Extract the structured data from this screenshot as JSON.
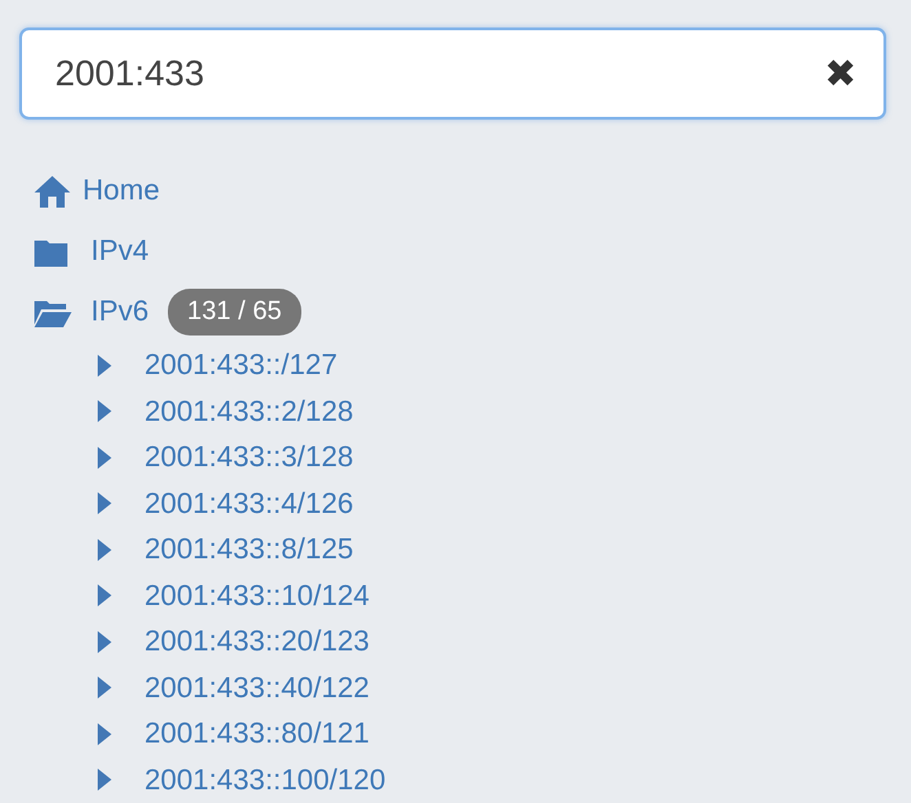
{
  "search": {
    "value": "2001:433",
    "clear_icon": "✖"
  },
  "tree": [
    {
      "label": "Home",
      "kind": "home"
    },
    {
      "label": "IPv4",
      "kind": "folder",
      "expanded": false
    },
    {
      "label": "IPv6",
      "kind": "folder",
      "expanded": true,
      "badge": "131 / 65",
      "children": [
        {
          "label": "2001:433::/127",
          "expanded": false
        },
        {
          "label": "2001:433::2/128",
          "expanded": false
        },
        {
          "label": "2001:433::3/128",
          "expanded": false
        },
        {
          "label": "2001:433::4/126",
          "expanded": false
        },
        {
          "label": "2001:433::8/125",
          "expanded": false
        },
        {
          "label": "2001:433::10/124",
          "expanded": false
        },
        {
          "label": "2001:433::20/123",
          "expanded": false
        },
        {
          "label": "2001:433::40/122",
          "expanded": false
        },
        {
          "label": "2001:433::80/121",
          "expanded": false
        },
        {
          "label": "2001:433::100/120",
          "expanded": false
        }
      ]
    }
  ]
}
